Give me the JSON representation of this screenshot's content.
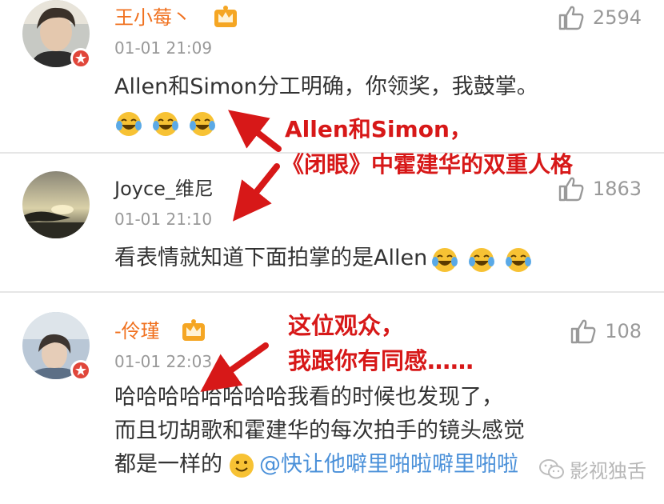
{
  "comments": [
    {
      "username": "王小莓丶",
      "time": "01-01 21:09",
      "likes": "2594",
      "text": "Allen和Simon分工明确，你领奖，我鼓掌。",
      "emoji_count": 3
    },
    {
      "username": "Joyce_维尼",
      "time": "01-01 21:10",
      "likes": "1863",
      "text": "看表情就知道下面拍掌的是Allen",
      "emoji_count": 3
    },
    {
      "username": "-伶瑾",
      "time": "01-01 22:03",
      "likes": "108",
      "text_line1": "哈哈哈哈哈哈哈哈我看的时候也发现了，",
      "text_line2": "而且切胡歌和霍建华的每次拍手的镜头感觉",
      "text_line3_prefix": "都是一样的",
      "mention": "@快让他噼里啪啦噼里啪啦"
    }
  ],
  "annotations": {
    "first_line1": "Allen和Simon，",
    "first_line2": "《闭眼》中霍建华的双重人格",
    "second_line1": "这位观众，",
    "second_line2": "我跟你有同感……"
  },
  "watermark": "影视独舌",
  "colors": {
    "username_orange": "#f0711f",
    "annotation_red": "#d71818",
    "mention_blue": "#4a90d9",
    "meta_gray": "#999999",
    "badge_red": "#e0463a"
  }
}
